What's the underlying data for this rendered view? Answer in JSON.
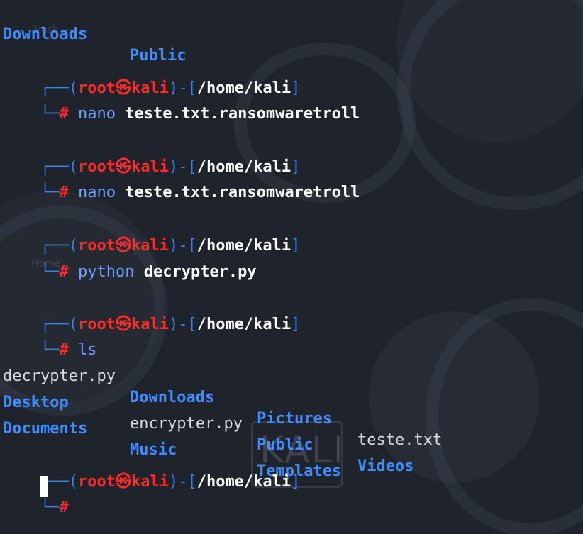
{
  "terminal": {
    "top_listing": [
      {
        "name": "Downloads",
        "type": "dir"
      },
      {
        "name": "Public",
        "type": "dir"
      }
    ],
    "prompt": {
      "user": "root",
      "separator_icon": "kali-dragon-symbol",
      "separator_glyph": "㉿",
      "host": "kali",
      "path": "/home/kali",
      "symbol": "#"
    },
    "sessions": [
      {
        "program": "nano",
        "argument": "teste.txt.ransomwaretroll"
      },
      {
        "program": "nano",
        "argument": "teste.txt.ransomwaretroll"
      },
      {
        "program": "python",
        "argument": "decrypter.py"
      },
      {
        "program": "ls",
        "argument": ""
      }
    ],
    "ls_output": [
      [
        {
          "name": "decrypter.py",
          "type": "file"
        },
        {
          "name": "Downloads",
          "type": "dir"
        },
        {
          "name": "Pictures",
          "type": "dir"
        },
        {
          "name": "teste.txt",
          "type": "file"
        }
      ],
      [
        {
          "name": "Desktop",
          "type": "dir"
        },
        {
          "name": "encrypter.py",
          "type": "file"
        },
        {
          "name": "Public",
          "type": "dir"
        },
        {
          "name": "Videos",
          "type": "dir"
        }
      ],
      [
        {
          "name": "Documents",
          "type": "dir"
        },
        {
          "name": "Music",
          "type": "dir"
        },
        {
          "name": "Templates",
          "type": "dir"
        }
      ]
    ],
    "background": {
      "watermark": "KALI",
      "desktop_labels": [
        "Trash",
        "Home"
      ]
    },
    "colors": {
      "background": "#1f232b",
      "directory": "#3f8cff",
      "prompt_user": "#ff2a2a",
      "frame": "#3b82e6",
      "text": "#d6dae2"
    }
  }
}
